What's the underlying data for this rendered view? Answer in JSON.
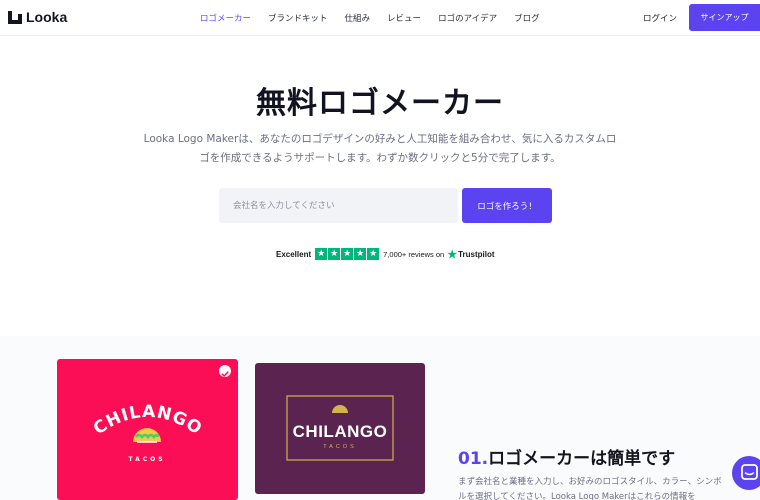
{
  "nav": {
    "logo_text": "Looka",
    "links": [
      "ロゴメーカー",
      "ブランドキット",
      "仕組み",
      "レビュー",
      "ロゴのアイデア",
      "ブログ"
    ],
    "login": "ログイン",
    "signup": "サインアップ"
  },
  "hero": {
    "title": "無料ロゴメーカー",
    "subtitle": "Looka Logo Makerは、あなたのロゴデザインの好みと人工知能を組み合わせ、気に入るカスタムロゴを作成できるようサポートします。わずか数クリックと5分で完了します。",
    "search_placeholder": "会社名を入力してください",
    "cta": "ロゴを作ろう！"
  },
  "trustpilot": {
    "label": "Excellent",
    "reviews": "7,000+ reviews on",
    "brand": "Trustpilot",
    "stars": 5
  },
  "examples": {
    "logo1": {
      "name": "CHILANGO",
      "sub": "TACOS"
    },
    "logo2": {
      "name": "CHILANGO",
      "sub": "TACOS"
    }
  },
  "feature": {
    "num": "01.",
    "title": "ロゴメーカーは簡単です",
    "desc": "まず会社名と業種を入力し、お好みのロゴスタイル、カラー、シンボルを選択してください。Looka Logo Makerはこれらの情報を"
  },
  "colors": {
    "accent": "#5b43f0",
    "pink_card": "#fb0e55",
    "purple_card": "#5b2450",
    "trustpilot_green": "#00b67a",
    "gold": "#d4b24c"
  }
}
